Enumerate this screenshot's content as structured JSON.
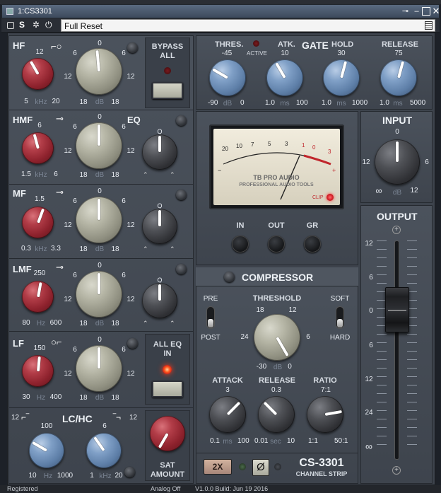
{
  "window": {
    "title": "1:CS3301",
    "pin_icon": "pin-icon",
    "minimize_icon": "minimize-icon",
    "maximize_icon": "maximize-icon",
    "close_icon": "close-icon"
  },
  "toolbar": {
    "preset": "Full Reset",
    "icons": [
      "switch-icon",
      "s-icon",
      "gear-icon",
      "power-icon"
    ],
    "preset_menu_icon": "preset-list-icon"
  },
  "eq": {
    "hf": {
      "title": "HF",
      "freq_unit": "kHz",
      "freq_ticks": [
        "12",
        "5",
        "20"
      ],
      "gain_ticks": [
        "0",
        "6",
        "6",
        "12",
        "12",
        "18",
        "18"
      ],
      "gain_unit": "dB"
    },
    "hmf": {
      "title": "HMF",
      "freq_unit": "kHz",
      "freq_ticks": [
        "6",
        "1.5",
        "6"
      ],
      "gain_ticks": [
        "0",
        "6",
        "6",
        "12",
        "12",
        "18",
        "18"
      ],
      "gain_unit": "dB",
      "q_label": "Q"
    },
    "mf": {
      "title": "MF",
      "freq_unit": "kHz",
      "freq_ticks": [
        "1.5",
        "0.3",
        "3.3"
      ],
      "gain_ticks": [
        "0",
        "6",
        "6",
        "12",
        "12",
        "18",
        "18"
      ],
      "gain_unit": "dB",
      "q_label": "Q"
    },
    "lmf": {
      "title": "LMF",
      "freq_unit": "Hz",
      "freq_ticks": [
        "250",
        "80",
        "600"
      ],
      "gain_ticks": [
        "0",
        "6",
        "6",
        "12",
        "12",
        "18",
        "18"
      ],
      "gain_unit": "dB",
      "q_label": "Q"
    },
    "lf": {
      "title": "LF",
      "freq_unit": "Hz",
      "freq_ticks": [
        "150",
        "30",
        "400"
      ],
      "gain_ticks": [
        "0",
        "6",
        "6",
        "12",
        "12",
        "18",
        "18"
      ],
      "gain_unit": "dB"
    },
    "eq_label": "EQ"
  },
  "bypass": {
    "label1": "BYPASS",
    "label2": "ALL"
  },
  "all_eq_in": {
    "label1": "ALL EQ",
    "label2": "IN"
  },
  "lchc": {
    "title": "LC/HC",
    "left_tick": "12",
    "right_tick": "12",
    "lc_ticks": [
      "100",
      "10",
      "1000"
    ],
    "lc_unit": "Hz",
    "hc_ticks": [
      "6",
      "1",
      "20"
    ],
    "hc_unit": "kHz"
  },
  "sat": {
    "label1": "SAT",
    "label2": "AMOUNT"
  },
  "gate": {
    "title": "GATE",
    "active": "ACTIVE",
    "thres": {
      "label": "THRES.",
      "top": "-45",
      "min": "-90",
      "unit": "dB",
      "max": "0"
    },
    "atk": {
      "label": "ATK.",
      "top": "10",
      "min": "1.0",
      "unit": "ms",
      "max": "100"
    },
    "hold": {
      "label": "HOLD",
      "top": "30",
      "min": "1.0",
      "unit": "ms",
      "max": "1000"
    },
    "release": {
      "label": "RELEASE",
      "top": "75",
      "min": "1.0",
      "unit": "ms",
      "max": "5000"
    }
  },
  "meter": {
    "brand": "TB PRO AUDIO",
    "sub": "PROFESSIONAL AUDIO TOOLS",
    "clip": "CLIP",
    "scale": [
      "20",
      "10",
      "7",
      "5",
      "3",
      "1",
      "0",
      "1",
      "3"
    ],
    "minus": "−",
    "plus": "+"
  },
  "meter_buttons": {
    "in": "IN",
    "out": "OUT",
    "gr": "GR"
  },
  "compressor": {
    "title": "COMPRESSOR",
    "pre": "PRE",
    "post": "POST",
    "soft": "SOFT",
    "hard": "HARD",
    "threshold": {
      "label": "THRESHOLD",
      "ticks": [
        "18",
        "12",
        "24",
        "6",
        "-30",
        "dB",
        "0"
      ]
    },
    "attack": {
      "label": "ATTACK",
      "top": "3",
      "min": "0.1",
      "unit": "ms",
      "max": "100"
    },
    "release": {
      "label": "RELEASE",
      "top": "0.3",
      "min": "0.01",
      "unit": "sec",
      "max": "10"
    },
    "ratio": {
      "label": "RATIO",
      "top": "7:1",
      "min": "1:1",
      "max": "50:1"
    }
  },
  "input": {
    "title": "INPUT",
    "ticks": [
      "0",
      "12",
      "6",
      "∞",
      "dB",
      "12"
    ]
  },
  "output": {
    "title": "OUTPUT",
    "scale": [
      "12",
      "6",
      "0",
      "6",
      "12",
      "24",
      "∞"
    ]
  },
  "bottom": {
    "oversample": "2X",
    "phase": "Ø",
    "model": "CS-3301",
    "model_sub": "CHANNEL STRIP"
  },
  "status": {
    "left": "Registered",
    "mid": "Analog Off",
    "right": "V1.0.0 Build: Jun 19 2016"
  },
  "colors": {
    "panel": "#444b54",
    "red_knob": "#a42e39",
    "gray_knob": "#a8a898",
    "blue_knob": "#6f8fb8",
    "led_red": "#e2222a"
  }
}
